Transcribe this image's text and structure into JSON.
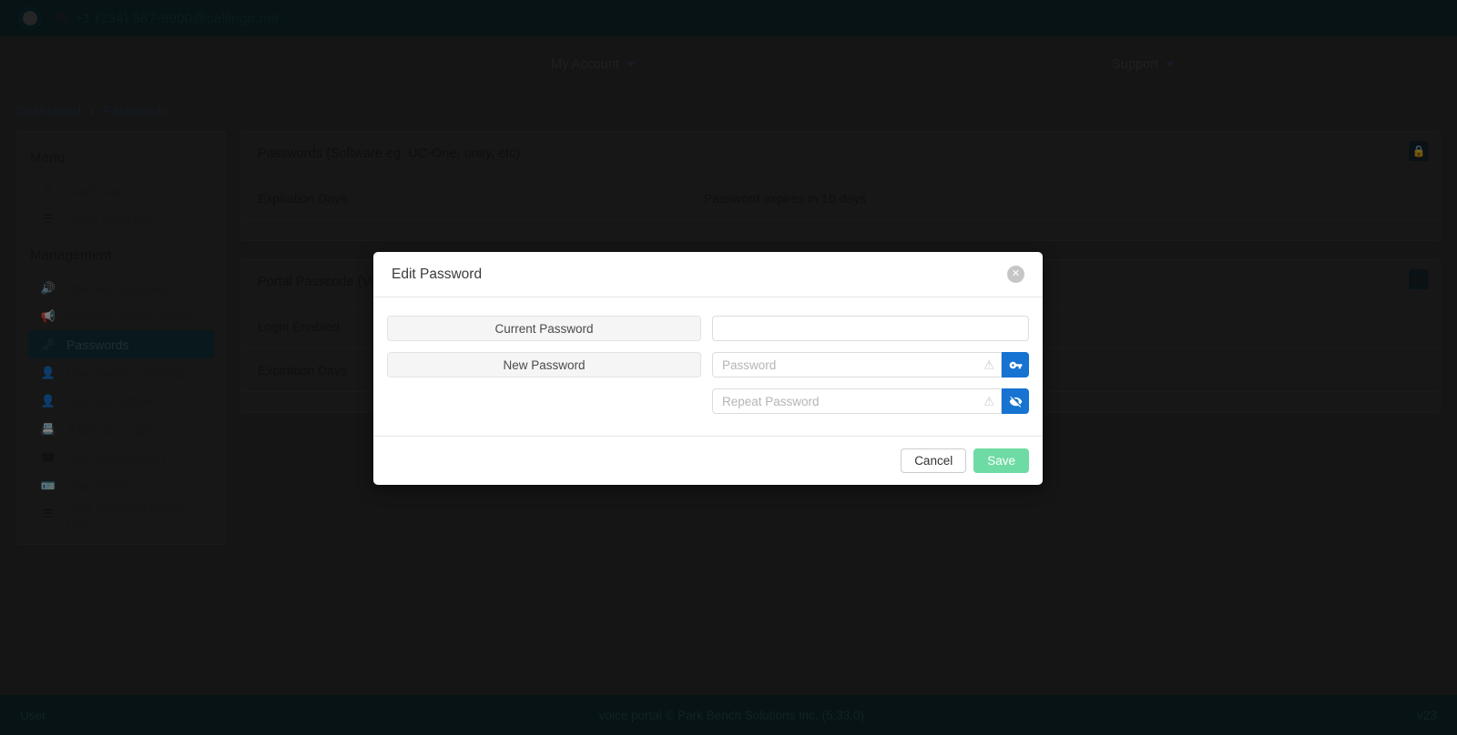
{
  "topbar": {
    "brand_text": "+1 (234) 567-8900@callingo.net",
    "phone_icon": "phone-icon",
    "logo_icon": "logo-circle"
  },
  "nav": {
    "my_account": "My Account",
    "support": "Support"
  },
  "breadcrumb": {
    "root": "Dashboard",
    "separator": "/",
    "current": "Passwords"
  },
  "sidebar": {
    "menu_heading": "Menu",
    "management_heading": "Management",
    "menu_items": [
      {
        "label": "Dashboard",
        "icon": "home-icon",
        "glyph": "⌂",
        "active": false
      },
      {
        "label": "Basic Call Logs",
        "icon": "list-icon",
        "glyph": "☰",
        "active": false
      }
    ],
    "management_items": [
      {
        "label": "User Announcements",
        "icon": "megaphone-icon",
        "glyph": "🔊",
        "active": false
      },
      {
        "label": "Meet-Me Conferencing",
        "icon": "conference-icon",
        "glyph": "📢",
        "active": false
      },
      {
        "label": "Passwords",
        "icon": "key-icon",
        "glyph": "🗝",
        "active": true
      },
      {
        "label": "User Service Settings",
        "icon": "user-gear-icon",
        "glyph": "👤",
        "active": false
      },
      {
        "label": "User Schedules",
        "icon": "user-clock-icon",
        "glyph": "👤",
        "active": false
      },
      {
        "label": "Alternate Login",
        "icon": "id-card-icon",
        "glyph": "📇",
        "active": false
      },
      {
        "label": "User Registration",
        "icon": "phone-icon",
        "glyph": "☎",
        "active": false
      },
      {
        "label": "User Profile",
        "icon": "profile-card-icon",
        "glyph": "🪪",
        "active": false
      },
      {
        "label": "User Personal Phone List",
        "icon": "list-icon",
        "glyph": "☰",
        "active": false
      }
    ]
  },
  "panels": [
    {
      "title": "Passwords (Software eg. UC-One, unity, etc)",
      "action_icon": "lock-icon",
      "action_glyph": "🔒",
      "rows": [
        {
          "label": "Expiration Days",
          "value": "Password expires in 10 days"
        }
      ]
    },
    {
      "title": "Portal Passcode (Voicemail)",
      "action_icon": "gear-icon",
      "action_glyph": "⚙",
      "rows": [
        {
          "label": "Login Enabled",
          "value": ""
        },
        {
          "label": "Expiration Days",
          "value": ""
        }
      ]
    }
  ],
  "modal": {
    "title": "Edit Password",
    "close_icon": "close-icon",
    "close_glyph": "✕",
    "fields": {
      "current_password_label": "Current Password",
      "current_password_value": "",
      "current_password_placeholder": "",
      "new_password_label": "New Password",
      "new_password_value": "",
      "new_password_placeholder": "Password",
      "repeat_password_value": "",
      "repeat_password_placeholder": "Repeat Password",
      "warning_icon": "warning-triangle-icon",
      "warning_glyph": "⚠",
      "generate_icon": "key-icon",
      "visibility_icon": "eye-slash-icon"
    },
    "cancel_label": "Cancel",
    "save_label": "Save",
    "colors": {
      "addon_blue": "#1673d1",
      "save_green": "#6fdba4"
    }
  },
  "footer": {
    "left": "User",
    "center": "voice portal © Park Bench Solutions Inc. (5.33.0)",
    "right": "v23"
  }
}
